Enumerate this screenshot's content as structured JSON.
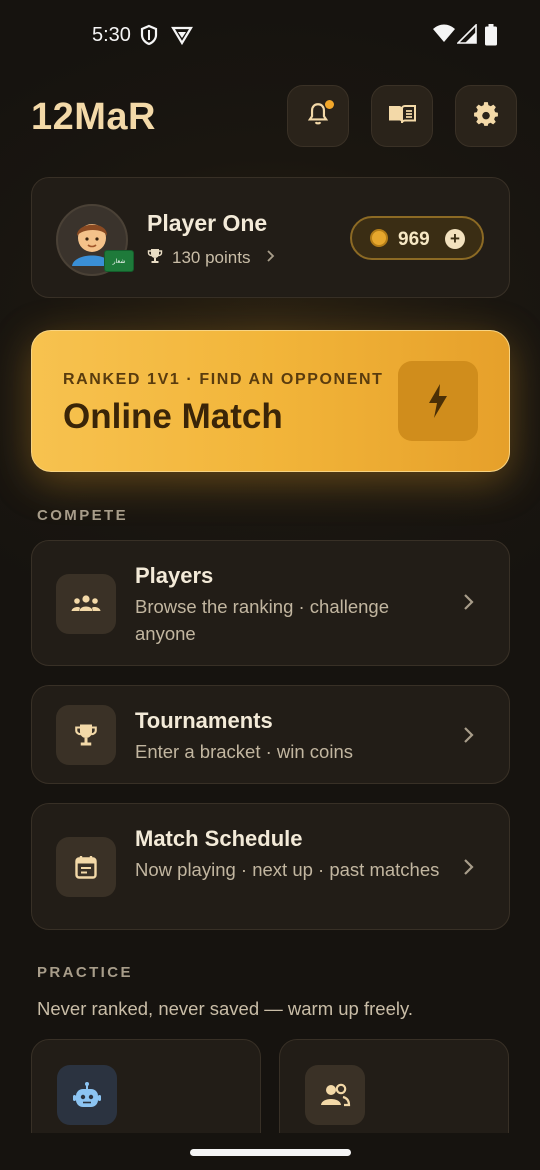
{
  "status_bar": {
    "time": "5:30"
  },
  "header": {
    "title": "12MaR"
  },
  "profile": {
    "name": "Player One",
    "points": "130 points",
    "coins": "969",
    "flag_text": "شعار"
  },
  "online_match": {
    "subtitle": "RANKED 1V1 · FIND AN OPPONENT",
    "title": "Online Match"
  },
  "compete": {
    "label": "COMPETE",
    "items": [
      {
        "title": "Players",
        "desc": "Browse the ranking · challenge anyone"
      },
      {
        "title": "Tournaments",
        "desc": "Enter a bracket · win coins"
      },
      {
        "title": "Match Schedule",
        "desc": "Now playing · next up · past matches"
      }
    ]
  },
  "practice": {
    "label": "PRACTICE",
    "text": "Never ranked, never saved — warm up freely."
  },
  "colors": {
    "accent": "#f2b53a",
    "background": "#16130f",
    "card": "#221d17"
  }
}
